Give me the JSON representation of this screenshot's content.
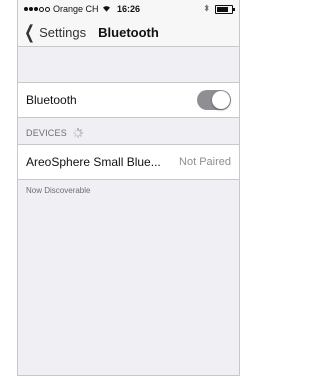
{
  "status_bar": {
    "carrier": "Orange CH",
    "time": "16:26",
    "icons": [
      "signal-dots-icon",
      "wifi-icon",
      "bluetooth-icon",
      "battery-icon"
    ]
  },
  "nav": {
    "back_label": "Settings",
    "title": "Bluetooth"
  },
  "bluetooth_row": {
    "label": "Bluetooth",
    "toggle_on": true
  },
  "devices": {
    "header": "DEVICES",
    "items": [
      {
        "name": "AreoSphere Small Blue...",
        "status": "Not Paired"
      }
    ]
  },
  "footer_text": "Now Discoverable",
  "colors": {
    "background": "#efeff4",
    "toggle": "#8e8e93",
    "separator": "#c8c7cc",
    "secondary_text": "#8e8e93"
  }
}
